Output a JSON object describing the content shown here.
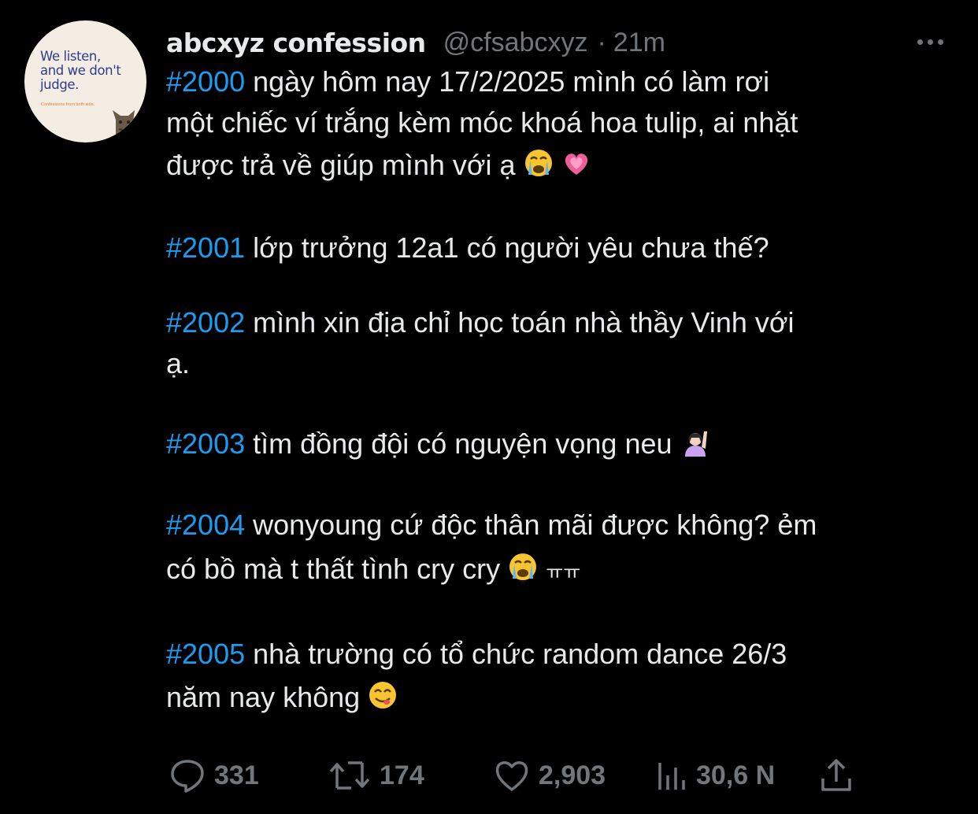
{
  "author": {
    "display_name": "abcxyz confession",
    "handle": "@cfsabcxyz",
    "separator": "·",
    "time": "21m",
    "avatar": {
      "line1": "We listen,",
      "line2": "and we don't",
      "line3": "judge.",
      "subtitle": "Confessions from both side."
    }
  },
  "post": {
    "entries": [
      {
        "tag": "#2000",
        "lines": [
          "ngày hôm nay 17/2/2025 mình có làm rơi",
          "một chiếc ví trắng kèm móc khoá hoa tulip, ai nhặt",
          "được trả về giúp mình với ạ"
        ],
        "emojis": [
          "loudly-crying-face",
          "growing-heart"
        ]
      },
      {
        "tag": "#2001",
        "lines": [
          "lớp trưởng 12a1 có người yêu chưa thế?"
        ],
        "emojis": []
      },
      {
        "tag": "#2002",
        "lines": [
          "mình xin địa chỉ học toán nhà thầy Vinh với",
          "ạ."
        ],
        "emojis": []
      },
      {
        "tag": "#2003",
        "lines": [
          "tìm đồng đội có nguyện vọng neu"
        ],
        "emojis": [
          "person-raising-hand"
        ]
      },
      {
        "tag": "#2004",
        "lines": [
          "wonyoung cứ độc thân mãi được không? ẻm",
          "có bồ mà t thất tình cry cry"
        ],
        "trailing": "ㅠㅠ",
        "emojis": [
          "loudly-crying-face"
        ]
      },
      {
        "tag": "#2005",
        "lines": [
          "nhà trường có tổ chức random dance 26/3",
          "năm nay không"
        ],
        "emojis": [
          "face-savoring-food"
        ]
      }
    ]
  },
  "actions": {
    "reply": {
      "icon": "reply-icon",
      "count": "331"
    },
    "retweet": {
      "icon": "retweet-icon",
      "count": "174"
    },
    "like": {
      "icon": "heart-icon",
      "count": "2,903"
    },
    "views": {
      "icon": "views-icon",
      "count": "30,6 N"
    },
    "share": {
      "icon": "share-icon"
    }
  },
  "colors": {
    "background": "#000000",
    "text": "#e7e9ea",
    "muted": "#71767b",
    "hashtag": "#1d9bf0"
  }
}
